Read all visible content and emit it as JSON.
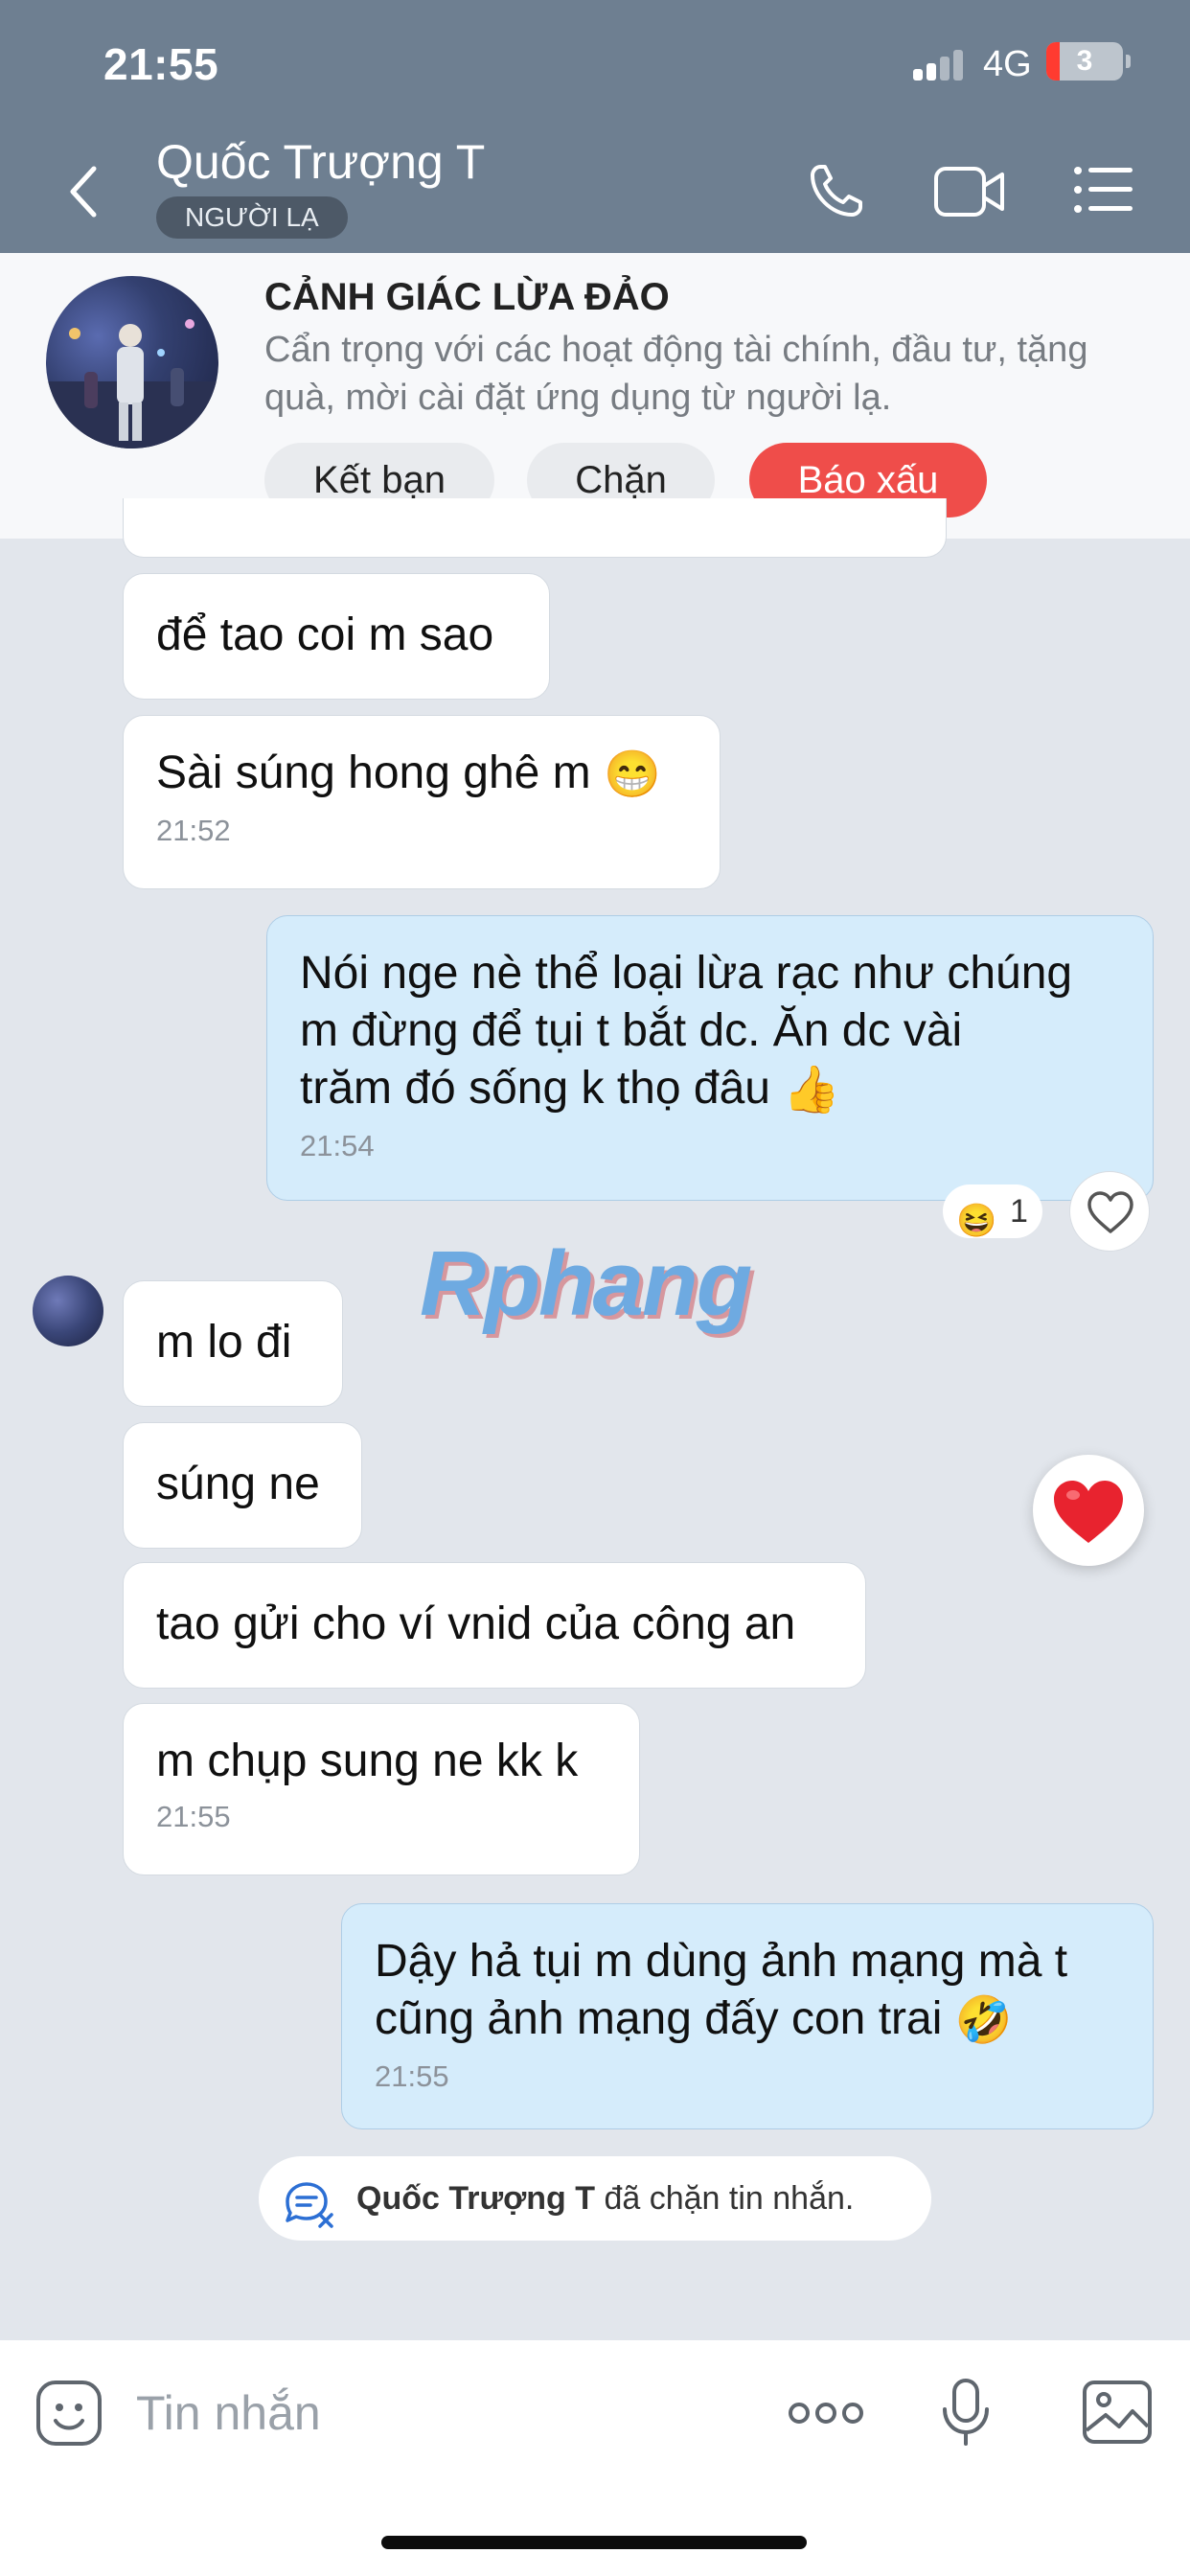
{
  "status_bar": {
    "time": "21:55",
    "network": "4G",
    "battery": "3"
  },
  "header": {
    "contact_name": "Quốc Trượng T",
    "badge": "NGƯỜI LẠ",
    "icons": [
      "back-icon",
      "phone-icon",
      "video-call-icon",
      "menu-icon"
    ]
  },
  "warning": {
    "title": "CẢNH GIÁC LỪA ĐẢO",
    "text": "Cẩn trọng với các hoạt động tài chính, đầu tư, tặng quà, mời cài đặt ứng dụng từ người lạ.",
    "buttons": {
      "add_friend": "Kết bạn",
      "block": "Chặn",
      "report": "Báo xấu"
    },
    "report_color": "#ef4d4a"
  },
  "messages": [
    {
      "dir": "in",
      "text": "để tao coi m sao"
    },
    {
      "dir": "in",
      "text": "Sài súng hong ghê m",
      "emoji": "😁",
      "time": "21:52"
    },
    {
      "dir": "out",
      "lines": [
        "Nói nge nè thể loại lừa rạc như chúng",
        "m đừng để tụi t bắt dc. Ăn dc vài",
        "trăm đó sống k thọ đâu"
      ],
      "emoji": "👍",
      "time": "21:54",
      "reaction": {
        "emoji": "😆",
        "count": "1"
      }
    },
    {
      "dir": "in",
      "text": "m lo đi"
    },
    {
      "dir": "in",
      "text": "súng ne"
    },
    {
      "dir": "in",
      "text": "tao gửi cho ví vnid của công an"
    },
    {
      "dir": "in",
      "text": "m chụp sung ne kk k",
      "time": "21:55"
    },
    {
      "dir": "out",
      "lines": [
        "Dậy hả tụi m dùng ảnh mạng mà t",
        "cũng ảnh mạng đấy con trai"
      ],
      "emoji": "🤣",
      "time": "21:55"
    }
  ],
  "watermark": "Rphang",
  "system_note": {
    "name": "Quốc Trượng T",
    "text": "đã chặn tin nhắn."
  },
  "input": {
    "placeholder": "Tin nhắn"
  },
  "colors": {
    "header_bg": "#6e7f91",
    "chat_bg": "#e2e6ec",
    "outgoing_bubble": "#d5ecfb",
    "incoming_bubble": "#ffffff"
  }
}
